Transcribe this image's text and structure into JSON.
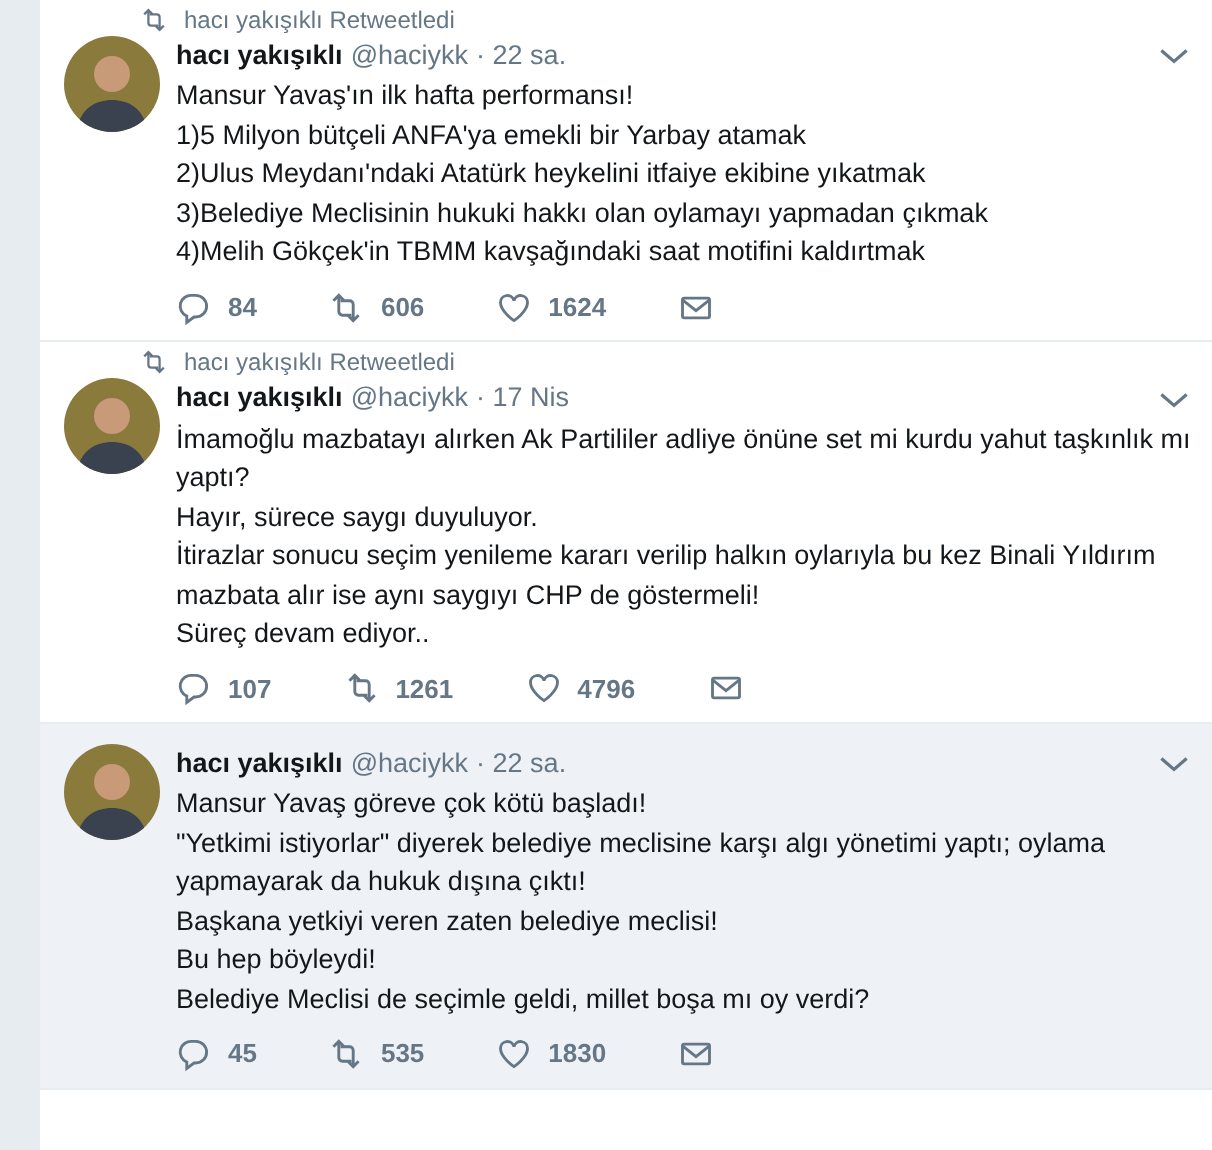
{
  "tweets": [
    {
      "retweeted_by": "hacı yakışıklı Retweetledi",
      "name": "hacı yakışıklı",
      "handle": "@haciykk",
      "time": "· 22 sa.",
      "highlighted": false,
      "lines": [
        "Mansur Yavaş'ın ilk hafta performansı!",
        "1)5 Milyon bütçeli ANFA'ya emekli bir Yarbay atamak",
        "2)Ulus Meydanı'ndaki Atatürk heykelini itfaiye ekibine yıkatmak",
        "3)Belediye Meclisinin hukuki hakkı olan oylamayı yapmadan çıkmak",
        "4)Melih Gökçek'in TBMM kavşağındaki saat motifini kaldırtmak"
      ],
      "replies": "84",
      "retweets": "606",
      "likes": "1624"
    },
    {
      "retweeted_by": "hacı yakışıklı Retweetledi",
      "name": "hacı yakışıklı",
      "handle": "@haciykk",
      "time": "· 17 Nis",
      "highlighted": false,
      "lines": [
        "İmamoğlu mazbatayı alırken Ak Partililer adliye önüne set mi kurdu yahut taşkınlık mı yaptı?",
        "Hayır, sürece saygı duyuluyor.",
        "İtirazlar sonucu seçim yenileme kararı verilip halkın oylarıyla bu kez Binali Yıldırım mazbata alır ise aynı saygıyı CHP de göstermeli!",
        "Süreç devam ediyor.."
      ],
      "replies": "107",
      "retweets": "1261",
      "likes": "4796"
    },
    {
      "name": "hacı yakışıklı",
      "handle": "@haciykk",
      "time": "· 22 sa.",
      "highlighted": true,
      "lines": [
        "Mansur Yavaş göreve çok kötü başladı!",
        "\"Yetkimi istiyorlar\" diyerek belediye meclisine karşı algı yönetimi yaptı; oylama yapmayarak da hukuk dışına çıktı!",
        "Başkana yetkiyi veren zaten belediye meclisi!",
        "Bu hep böyleydi!",
        "Belediye Meclisi de seçimle geldi, millet boşa mı oy verdi?"
      ],
      "replies": "45",
      "retweets": "535",
      "likes": "1830"
    }
  ]
}
